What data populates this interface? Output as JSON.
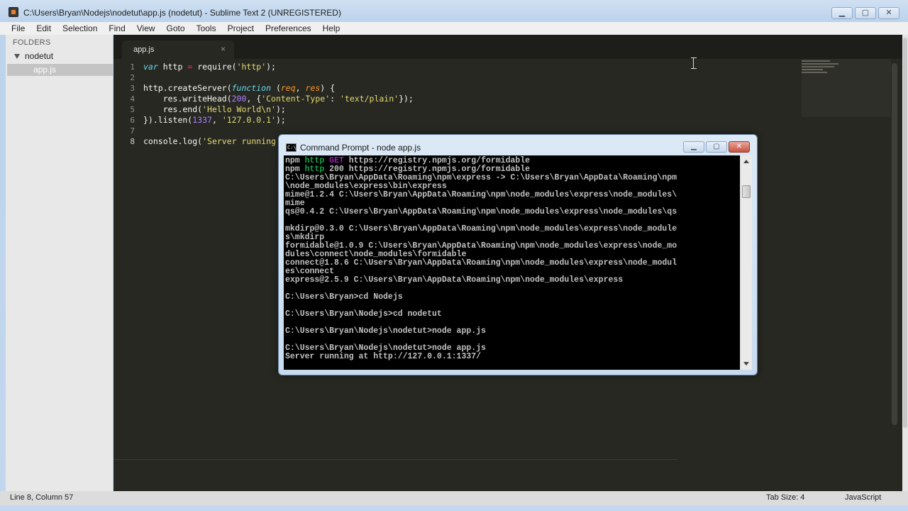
{
  "window": {
    "title": "C:\\Users\\Bryan\\Nodejs\\nodetut\\app.js (nodetut) - Sublime Text 2 (UNREGISTERED)",
    "minimize": "▁",
    "maximize": "▢",
    "close": "✕"
  },
  "menu": [
    "File",
    "Edit",
    "Selection",
    "Find",
    "View",
    "Goto",
    "Tools",
    "Project",
    "Preferences",
    "Help"
  ],
  "sidebar": {
    "header": "FOLDERS",
    "folder": "nodetut",
    "file": "app.js"
  },
  "tab": {
    "label": "app.js",
    "close": "×"
  },
  "line_numbers": [
    "1",
    "2",
    "3",
    "4",
    "5",
    "6",
    "7",
    "8"
  ],
  "code": {
    "l1": {
      "kw": "var",
      "a": " http ",
      "op": "=",
      "b": " require(",
      "s": "'http'",
      "c": ");"
    },
    "l3": {
      "a": "http.createServer(",
      "kw": "function",
      "b": " (",
      "p1": "req",
      "c": ", ",
      "p2": "res",
      "d": ") {"
    },
    "l4": {
      "a": "    res.writeHead(",
      "n": "200",
      "b": ", {",
      "s1": "'Content-Type'",
      "c": ": ",
      "s2": "'text/plain'",
      "d": "});"
    },
    "l5": {
      "a": "    res.end(",
      "s": "'Hello World\\n'",
      "b": ");"
    },
    "l6": {
      "a": "}).listen(",
      "n": "1337",
      "b": ", ",
      "s": "'127.0.0.1'",
      "c": ");"
    },
    "l8": {
      "a": "console.log(",
      "s": "'Server running"
    }
  },
  "status": {
    "position": "Line 8, Column 57",
    "tab_size": "Tab Size: 4",
    "syntax": "JavaScript"
  },
  "cmd": {
    "title": "Command Prompt - node  app.js",
    "icon_text": "C:\\",
    "minimize": "▁",
    "maximize": "▢",
    "close": "✕",
    "lines": [
      {
        "a": "npm ",
        "g": "http ",
        "m": "GET",
        "b": " https://registry.npmjs.org/formidable"
      },
      {
        "a": "npm ",
        "g": "http ",
        "m": "",
        "b": "200 https://registry.npmjs.org/formidable"
      },
      {
        "a": "C:\\Users\\Bryan\\AppData\\Roaming\\npm\\express -> C:\\Users\\Bryan\\AppData\\Roaming\\npm"
      },
      {
        "a": "\\node_modules\\express\\bin\\express"
      },
      {
        "a": "mime@1.2.4 C:\\Users\\Bryan\\AppData\\Roaming\\npm\\node_modules\\express\\node_modules\\"
      },
      {
        "a": "mime"
      },
      {
        "a": "qs@0.4.2 C:\\Users\\Bryan\\AppData\\Roaming\\npm\\node_modules\\express\\node_modules\\qs"
      },
      {
        "a": ""
      },
      {
        "a": "mkdirp@0.3.0 C:\\Users\\Bryan\\AppData\\Roaming\\npm\\node_modules\\express\\node_module"
      },
      {
        "a": "s\\mkdirp"
      },
      {
        "a": "formidable@1.0.9 C:\\Users\\Bryan\\AppData\\Roaming\\npm\\node_modules\\express\\node_mo"
      },
      {
        "a": "dules\\connect\\node_modules\\formidable"
      },
      {
        "a": "connect@1.8.6 C:\\Users\\Bryan\\AppData\\Roaming\\npm\\node_modules\\express\\node_modul"
      },
      {
        "a": "es\\connect"
      },
      {
        "a": "express@2.5.9 C:\\Users\\Bryan\\AppData\\Roaming\\npm\\node_modules\\express"
      },
      {
        "a": ""
      },
      {
        "a": "C:\\Users\\Bryan>cd Nodejs"
      },
      {
        "a": ""
      },
      {
        "a": "C:\\Users\\Bryan\\Nodejs>cd nodetut"
      },
      {
        "a": ""
      },
      {
        "a": "C:\\Users\\Bryan\\Nodejs\\nodetut>node app.js"
      },
      {
        "a": ""
      },
      {
        "a": "C:\\Users\\Bryan\\Nodejs\\nodetut>node app.js"
      },
      {
        "a": "Server running at http://127.0.0.1:1337/"
      }
    ]
  }
}
